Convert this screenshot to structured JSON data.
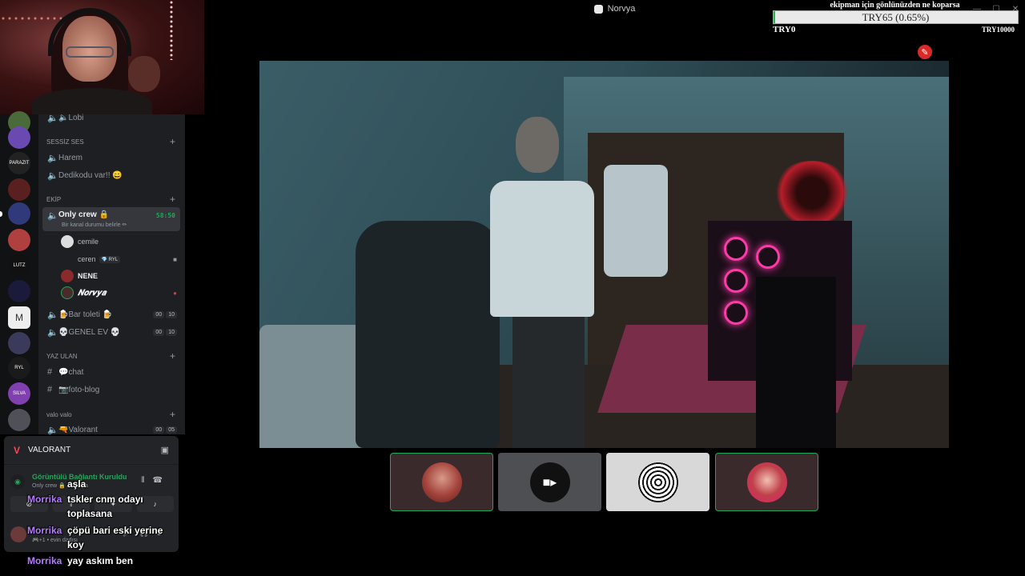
{
  "window": {
    "title": "Norvya",
    "controls": [
      "—",
      "☐",
      "✕"
    ]
  },
  "rail": {
    "servers": [
      {
        "label": "",
        "color": "#4a6a3a"
      },
      {
        "label": "",
        "color": "#6a4ab0"
      },
      {
        "label": "PARAZIT",
        "color": "#222222"
      },
      {
        "label": "",
        "color": "#5a2020"
      },
      {
        "label": "",
        "color": "#303a7a"
      },
      {
        "label": "",
        "color": "#b04040"
      },
      {
        "label": "LUTZ",
        "color": "#111111"
      },
      {
        "label": "",
        "color": "#1a1a3a"
      },
      {
        "label": "M",
        "color": "#eeeeee"
      },
      {
        "label": "",
        "color": "#3a3a5a"
      },
      {
        "label": "RYL",
        "color": "#1a1a1a"
      },
      {
        "label": "SILVA",
        "color": "#8040b0"
      },
      {
        "label": "",
        "color": "#505058"
      }
    ]
  },
  "sidebar": {
    "top_channel": "🔈Lobi",
    "categories": {
      "sessiz": "SESSİZ SES",
      "ekip": "EKİP",
      "yaz": "YAZ ULAN",
      "valo": "valo valo"
    },
    "channels": {
      "harem": "Harem",
      "dedikodu": "Dedikodu var!! 😄",
      "only_crew": "Only crew 🔒",
      "only_crew_time": "58:50",
      "only_crew_status": "Bir kanal durumu belirle ✏",
      "bar": "🍺Bar toleti 🍺",
      "bar_badges": [
        "00",
        "10"
      ],
      "genel": "💀GENEL EV 💀",
      "genel_badges": [
        "00",
        "10"
      ],
      "chat": "💬chat",
      "foto": "📷foto-blog",
      "valorant": "🔫Valorant",
      "valorant_badges": [
        "00",
        "05"
      ]
    },
    "members": {
      "m1": "cemile",
      "m2": "ceren",
      "m2_tag": "💎 RYL",
      "m3": "NENE",
      "m4": "𝑵𝒐𝒓𝒗𝒚𝒂"
    }
  },
  "panel": {
    "game": "VALORANT",
    "voice_status": "Görüntülü Bağlantı Kuruldu",
    "voice_location": "Only crew 🔒 / Norvya",
    "user_status": "🎮+1 • evin dadısı"
  },
  "chat": [
    {
      "nick": "",
      "text": "aşla"
    },
    {
      "nick": "Morrika",
      "text": "tskler cnm odayı toplasana"
    },
    {
      "nick": "Morrika",
      "text": "çöpü bari eski yerine koy"
    },
    {
      "nick": "Morrika",
      "text": "yay askım ben"
    }
  ],
  "goal": {
    "title": "ekipman için gönlünüzden ne koparsa",
    "amount": "TRY65 (0.65%)",
    "progress": 0.0065,
    "min": "TRY0",
    "max": "TRY10000",
    "fill_color": "#1db954"
  },
  "tiles": [
    {
      "name": "participant-1",
      "speaking": true
    },
    {
      "name": "participant-2-camera-off",
      "icon": "video-camera-icon"
    },
    {
      "name": "participant-3",
      "speaking": false
    },
    {
      "name": "participant-4",
      "speaking": true
    }
  ],
  "colors": {
    "online_green": "#23a559",
    "chat_nick": "#b57bff",
    "valorant_red": "#ff4655"
  }
}
